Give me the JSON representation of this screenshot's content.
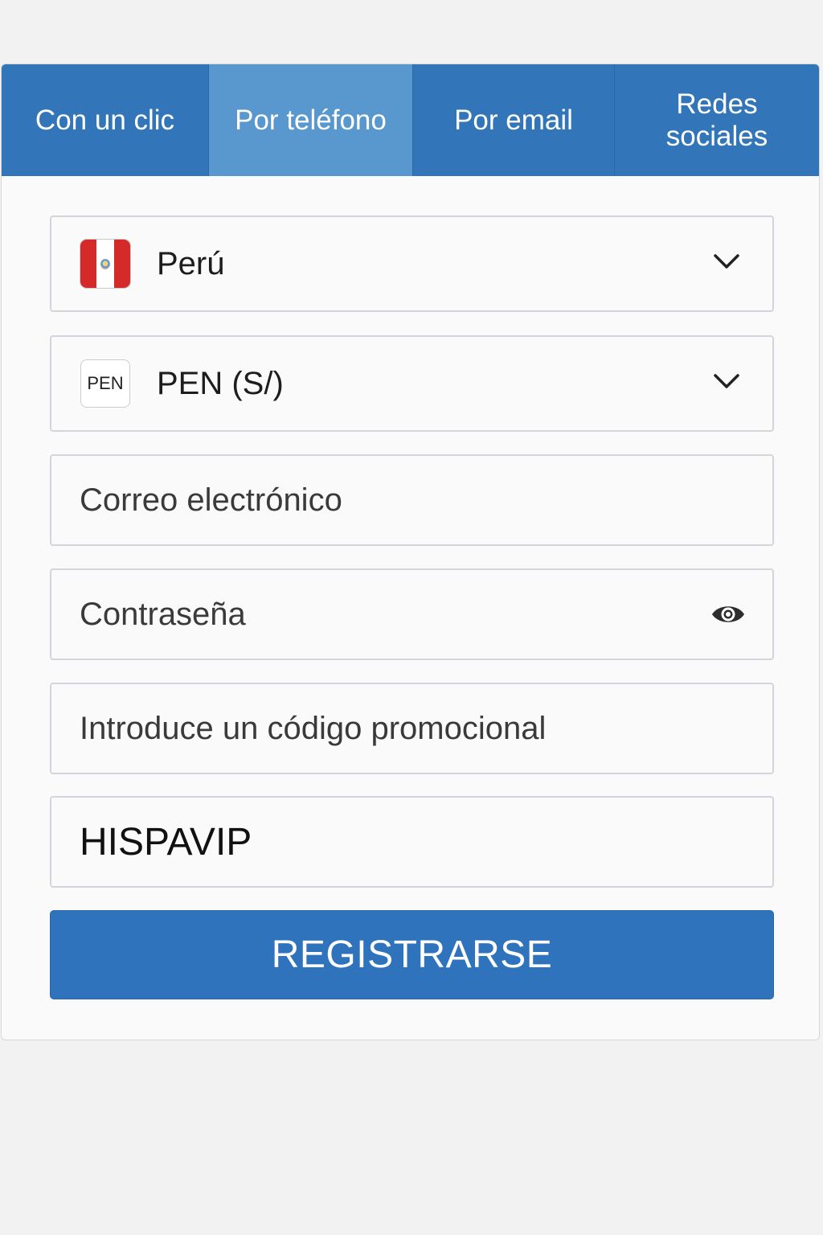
{
  "tabs": [
    {
      "label": "Con un clic",
      "active": false
    },
    {
      "label": "Por teléfono",
      "active": true
    },
    {
      "label": "Por email",
      "active": false
    },
    {
      "label": "Redes sociales",
      "active": false
    }
  ],
  "form": {
    "country": {
      "value": "Perú",
      "icon": "peru-flag-icon"
    },
    "currency": {
      "value": "PEN (S/)",
      "badge": "PEN"
    },
    "email": {
      "placeholder": "Correo electrónico"
    },
    "password": {
      "placeholder": "Contraseña",
      "icon": "eye-icon"
    },
    "promo": {
      "placeholder": "Introduce un código promocional"
    },
    "promo_code": {
      "value": "HISPAVIP"
    },
    "submit_label": "REGISTRARSE"
  },
  "colors": {
    "tab_bar": "#3276b9",
    "tab_active": "#5997cf",
    "button": "#2f73bd",
    "page_background": "#f2f2f2"
  }
}
